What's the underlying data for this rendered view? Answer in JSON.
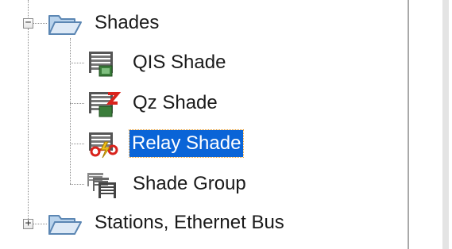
{
  "tree": {
    "shades_folder": {
      "label": "Shades",
      "expanded": true,
      "expander_glyph": "−",
      "icon": "folder-open-icon"
    },
    "children": [
      {
        "label": "QIS Shade",
        "icon": "qis-shade-icon",
        "selected": false
      },
      {
        "label": "Qz Shade",
        "icon": "qz-shade-icon",
        "selected": false
      },
      {
        "label": "Relay Shade",
        "icon": "relay-shade-icon",
        "selected": true
      },
      {
        "label": "Shade Group",
        "icon": "shade-group-icon",
        "selected": false
      }
    ],
    "stations_folder": {
      "label": "Stations, Ethernet Bus",
      "expanded": false,
      "expander_glyph": "+",
      "icon": "folder-icon"
    }
  },
  "colors": {
    "selection": "#0a64d7",
    "folder": "#6f9fc8",
    "shade_red": "#d9231c",
    "shade_gray": "#666666"
  }
}
